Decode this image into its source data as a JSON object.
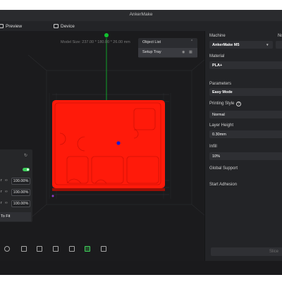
{
  "app": {
    "title": "AnkerMake"
  },
  "toolbar": {
    "preview_label": "Preview",
    "device_label": "Device"
  },
  "viewport": {
    "model_size": "Model Size: 237.00 * 180.00 * 26.00 mm"
  },
  "object_panel": {
    "title": "Object List",
    "items": [
      "Setup Tray"
    ]
  },
  "left_panel": {
    "rows": [
      {
        "label": "r",
        "value": "100.00%"
      },
      {
        "label": "r",
        "value": "100.00%"
      },
      {
        "label": "r",
        "value": "100.00%"
      }
    ],
    "fit_label": "To Fit"
  },
  "sidebar": {
    "machine_label": "Machine",
    "machine_value": "AnkerMake M5",
    "nozzle_label": "No",
    "material_label": "Material",
    "material_value": "PLA+",
    "parameters_label": "Parameters",
    "parameters_value": "Easy Mode",
    "printing_style_label": "Printing Style",
    "printing_style_value": "Normal",
    "layer_height_label": "Layer Height",
    "layer_height_value": "0.30mm",
    "infill_label": "Infill",
    "infill_value": "10%",
    "global_support_label": "Global Support",
    "start_adhesion_label": "Start Adhesion",
    "slice_label": "Slice"
  },
  "colors": {
    "model": "#ff1a0a",
    "accent_green": "#3dcc5a",
    "background": "#1c1d20"
  },
  "icons": [
    "help-icon",
    "eye-icon",
    "delete-icon",
    "refresh-icon",
    "link-icon",
    "chevron-down-icon",
    "view-cube-icon"
  ]
}
